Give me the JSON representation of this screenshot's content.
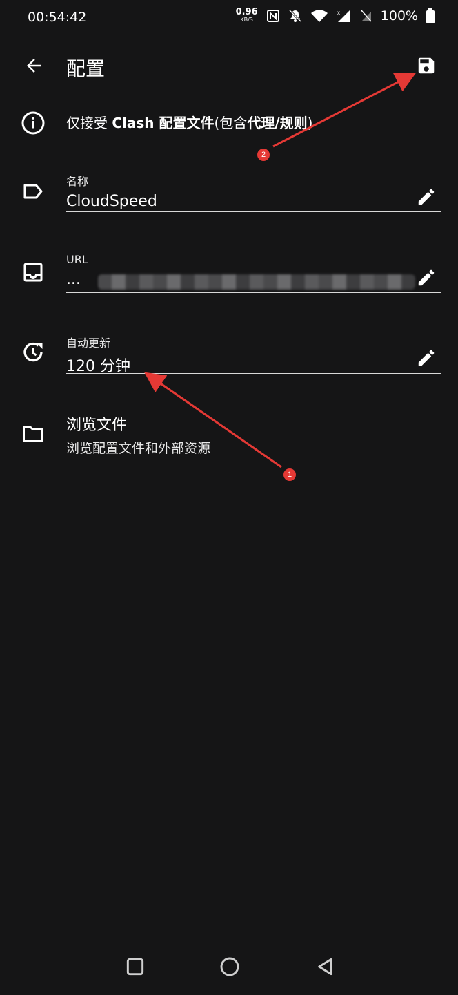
{
  "status": {
    "time": "00:54:42",
    "speed_value": "0.96",
    "speed_unit": "KB/S",
    "battery": "100%"
  },
  "toolbar": {
    "title": "配置",
    "back_icon": "arrow-left-icon",
    "save_icon": "save-icon"
  },
  "info": {
    "prefix": "仅接受 ",
    "bold1": "Clash 配置文件",
    "mid": "(包含",
    "bold2": "代理/规则",
    "suffix": ")"
  },
  "fields": {
    "name": {
      "label": "名称",
      "value": "CloudSpeed"
    },
    "url": {
      "label": "URL",
      "value": "..."
    },
    "auto_update": {
      "label": "自动更新",
      "value": "120 分钟"
    }
  },
  "browse": {
    "title": "浏览文件",
    "subtitle": "浏览配置文件和外部资源"
  },
  "annotations": {
    "marker1": "1",
    "marker2": "2",
    "color": "#e53935"
  },
  "colors": {
    "background": "#151516",
    "text": "#ffffff",
    "divider": "#d8d8d8"
  }
}
